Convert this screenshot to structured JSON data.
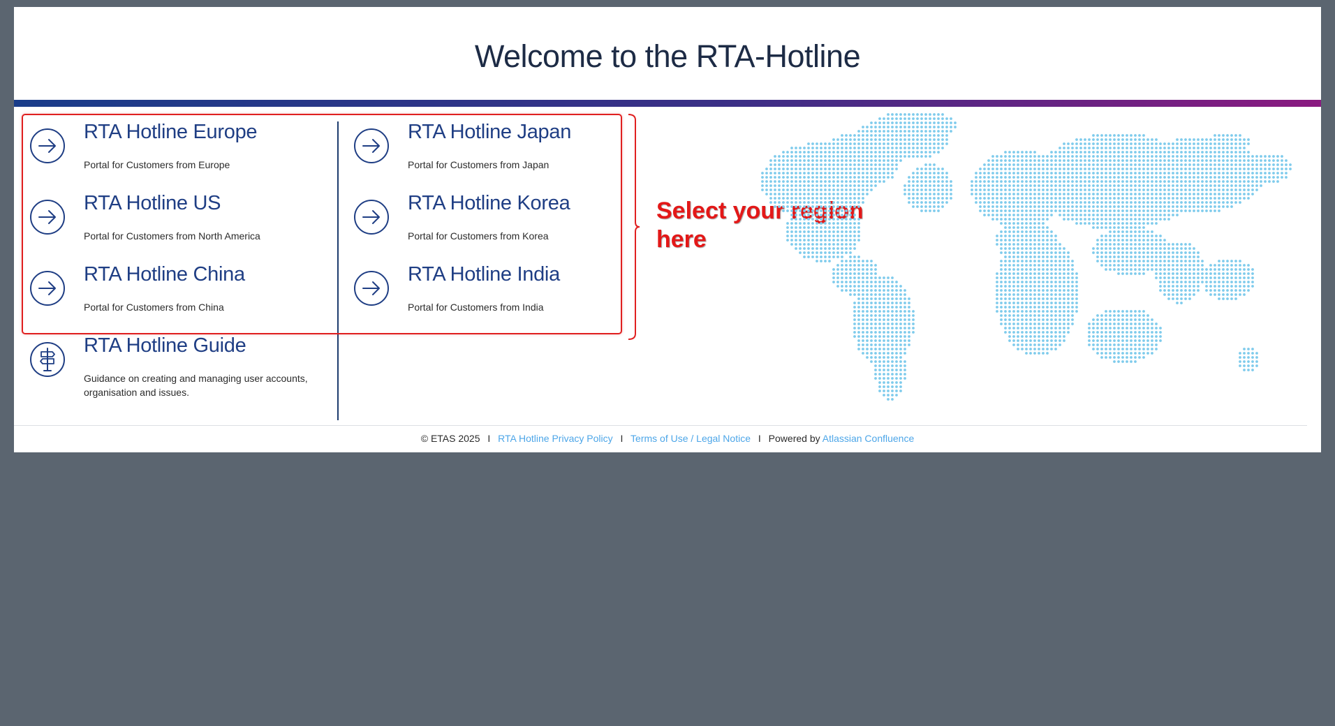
{
  "header": {
    "title": "Welcome to the RTA-Hotline"
  },
  "regions": [
    {
      "name": "RTA Hotline Europe",
      "desc": "Portal for Customers from Europe"
    },
    {
      "name": "RTA Hotline US",
      "desc": "Portal for Customers from North America"
    },
    {
      "name": "RTA Hotline China",
      "desc": "Portal for Customers from China"
    },
    {
      "name": "RTA Hotline Japan",
      "desc": "Portal for Customers from Japan"
    },
    {
      "name": "RTA Hotline Korea",
      "desc": "Portal for Customers from Korea"
    },
    {
      "name": "RTA Hotline India",
      "desc": "Portal for Customers from India"
    }
  ],
  "guide": {
    "name": "RTA Hotline Guide",
    "desc": "Guidance on creating and managing user accounts, organisation and issues.",
    "icon": "signpost-icon"
  },
  "annotation": {
    "text": "Select your region here"
  },
  "footer": {
    "copyright": "© ETAS 2025",
    "separator": "I",
    "privacy": "RTA Hotline Privacy Policy",
    "terms": "Terms of Use / Legal Notice",
    "powered_by": "Powered by",
    "confluence": "Atlassian Confluence"
  },
  "colors": {
    "accent": "#1f3e84",
    "annotation": "#e31818",
    "map_dots": "#7fcbec",
    "link": "#4da6e8"
  }
}
